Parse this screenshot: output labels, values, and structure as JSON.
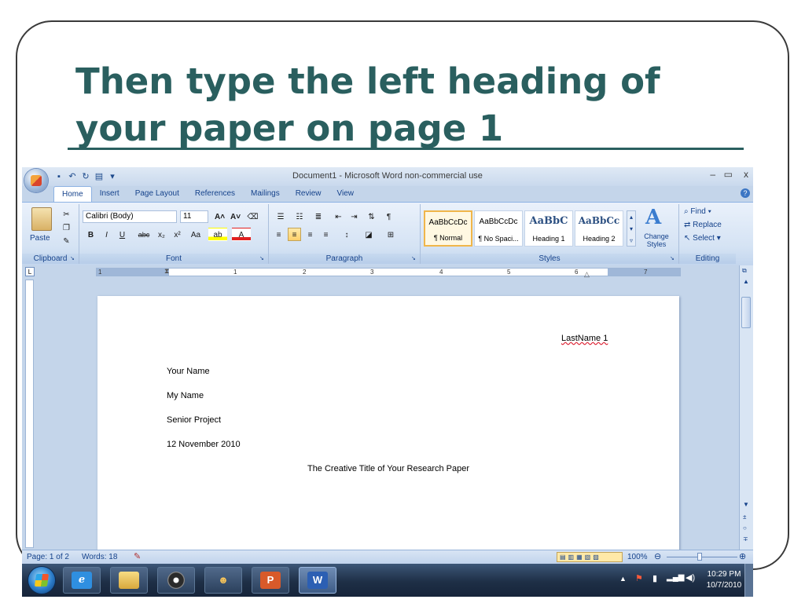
{
  "slide": {
    "title": "Then type the left heading of your paper on page 1"
  },
  "window": {
    "title": "Document1 - Microsoft Word non-commercial use",
    "minimize": "–",
    "restore": "▭",
    "close": "x"
  },
  "qat": {
    "save": "▪",
    "undo": "↶",
    "redo": "↻",
    "open": "▤",
    "more": "▾"
  },
  "tabs": [
    "Home",
    "Insert",
    "Page Layout",
    "References",
    "Mailings",
    "Review",
    "View"
  ],
  "ribbon": {
    "clipboard": {
      "label": "Clipboard",
      "paste": "Paste"
    },
    "font": {
      "label": "Font",
      "font_name": "Calibri (Body)",
      "font_size": "11",
      "bold": "B",
      "italic": "I",
      "underline": "U",
      "strike": "abc",
      "subscript": "x₂",
      "superscript": "x²",
      "change_case": "Aa",
      "grow": "A˄",
      "shrink": "A˅"
    },
    "paragraph": {
      "label": "Paragraph"
    },
    "styles": {
      "label": "Styles",
      "items": [
        {
          "sample": "AaBbCcDc",
          "name": "¶ Normal"
        },
        {
          "sample": "AaBbCcDc",
          "name": "¶ No Spaci..."
        },
        {
          "sample": "AaBbC",
          "name": "Heading 1"
        },
        {
          "sample": "AaBbCc",
          "name": "Heading 2"
        }
      ],
      "change_styles": "Change Styles"
    },
    "editing": {
      "label": "Editing",
      "find": "Find",
      "replace": "Replace",
      "select": "Select"
    }
  },
  "ruler": {
    "numbers": [
      "1",
      "1",
      "2",
      "3",
      "4",
      "5",
      "6",
      "7"
    ]
  },
  "document": {
    "header": "LastName 1",
    "lines": [
      "Your Name",
      "My Name",
      "Senior Project",
      "12 November 2010"
    ],
    "title": "The Creative Title of Your Research Paper"
  },
  "status": {
    "page": "Page: 1 of 2",
    "words": "Words: 18",
    "zoom": "100%"
  },
  "tray": {
    "time": "10:29 PM",
    "date": "10/7/2010"
  },
  "colors": {
    "slide_title": "#2a5f5f",
    "ribbon": "#d5e3f4",
    "taskbar": "#1e2f46"
  }
}
